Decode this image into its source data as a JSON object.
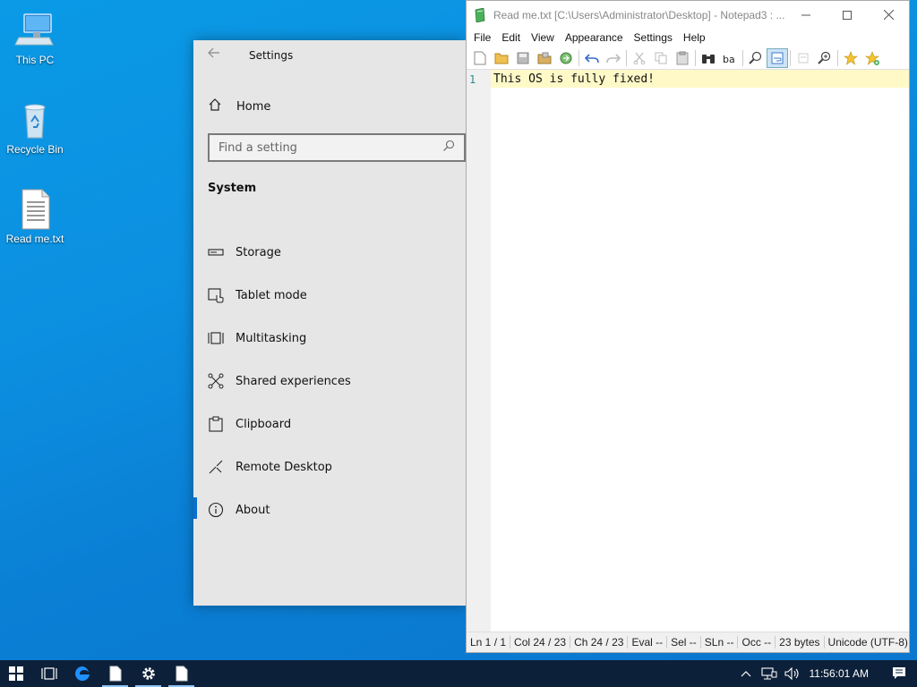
{
  "desktop": {
    "icons": [
      {
        "label": "This PC",
        "icon": "computer-icon"
      },
      {
        "label": "Recycle Bin",
        "icon": "recycle-bin-icon"
      },
      {
        "label": "Read me.txt",
        "icon": "text-file-icon"
      }
    ]
  },
  "settings": {
    "title": "Settings",
    "home_label": "Home",
    "search_placeholder": "Find a setting",
    "section": "System",
    "items": [
      {
        "label": "Storage",
        "icon": "storage-icon"
      },
      {
        "label": "Tablet mode",
        "icon": "tablet-mode-icon"
      },
      {
        "label": "Multitasking",
        "icon": "multitasking-icon"
      },
      {
        "label": "Shared experiences",
        "icon": "shared-experiences-icon"
      },
      {
        "label": "Clipboard",
        "icon": "clipboard-icon"
      },
      {
        "label": "Remote Desktop",
        "icon": "remote-desktop-icon"
      },
      {
        "label": "About",
        "icon": "info-icon"
      }
    ],
    "selected": "About"
  },
  "notepad": {
    "title": "Read me.txt [C:\\Users\\Administrator\\Desktop] - Notepad3 : ...",
    "menu": [
      "File",
      "Edit",
      "View",
      "Appearance",
      "Settings",
      "Help"
    ],
    "line_number": "1",
    "content": "This OS is fully fixed!",
    "status": [
      "Ln  1 / 1",
      "Col  24 / 23",
      "Ch  24 / 23",
      "Eval  --",
      "Sel  --",
      "SLn  --",
      "Occ  --",
      "23 bytes",
      "Unicode (UTF-8)"
    ]
  },
  "taskbar": {
    "clock": "11:56:01 AM"
  },
  "colors": {
    "desktop_blue": "#0a8fe0",
    "taskbar": "#0d2039",
    "accent": "#0a6fd1",
    "current_line": "#fff9c8"
  }
}
